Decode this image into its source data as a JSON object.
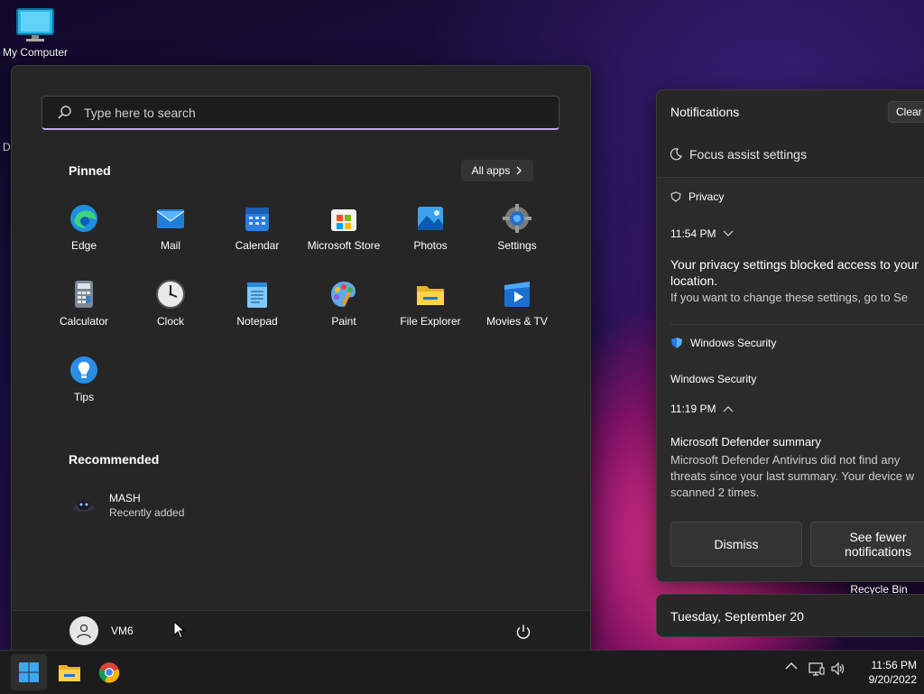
{
  "desktop": {
    "my_computer_label": "My Computer",
    "recycle_bin_label": "Recycle Bin",
    "partial_label": "Da"
  },
  "start_menu": {
    "search_placeholder": "Type here to search",
    "pinned_title": "Pinned",
    "all_apps_label": "All apps",
    "pinned_apps": [
      {
        "label": "Edge",
        "icon": "edge-icon"
      },
      {
        "label": "Mail",
        "icon": "mail-icon"
      },
      {
        "label": "Calendar",
        "icon": "calendar-icon"
      },
      {
        "label": "Microsoft Store",
        "icon": "store-icon"
      },
      {
        "label": "Photos",
        "icon": "photos-icon"
      },
      {
        "label": "Settings",
        "icon": "settings-icon"
      },
      {
        "label": "Calculator",
        "icon": "calculator-icon"
      },
      {
        "label": "Clock",
        "icon": "clock-icon"
      },
      {
        "label": "Notepad",
        "icon": "notepad-icon"
      },
      {
        "label": "Paint",
        "icon": "paint-icon"
      },
      {
        "label": "File Explorer",
        "icon": "folder-icon"
      },
      {
        "label": "Movies & TV",
        "icon": "movies-icon"
      },
      {
        "label": "Tips",
        "icon": "tips-icon"
      }
    ],
    "recommended_title": "Recommended",
    "recommended": [
      {
        "title": "MASH",
        "subtitle": "Recently added"
      }
    ],
    "user_name": "VM6"
  },
  "notifications": {
    "title": "Notifications",
    "clear_label": "Clear a",
    "focus_assist": "Focus assist settings",
    "privacy_app": "Privacy",
    "privacy_time": "11:54 PM",
    "privacy_heading": "Your privacy settings blocked access to your",
    "privacy_heading_2": "location.",
    "privacy_body": "If you want to change these settings, go to Se",
    "security_app": "Windows Security",
    "security_group": "Windows Security",
    "security_time": "11:19 PM",
    "defender_heading": "Microsoft Defender summary",
    "defender_body_1": "Microsoft Defender Antivirus did not find any",
    "defender_body_2": "threats since your last summary. Your device w",
    "defender_body_3": "scanned 2 times.",
    "dismiss_label": "Dismiss",
    "see_fewer_1": "See fewer",
    "see_fewer_2": "notifications"
  },
  "calendar": {
    "date_label": "Tuesday, September 20"
  },
  "taskbar": {
    "time": "11:56 PM",
    "date": "9/20/2022"
  },
  "colors": {
    "accent_underline": "#c8a6e8",
    "start_bg": "#262626",
    "taskbar_bg": "#1c1c1c"
  }
}
